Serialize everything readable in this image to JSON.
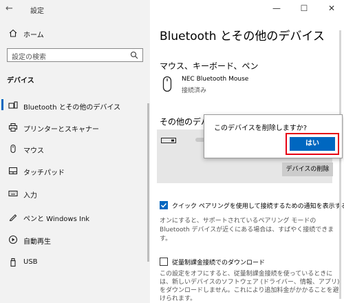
{
  "app": {
    "title": "設定"
  },
  "window": {
    "minimize": "—",
    "maximize": "☐",
    "close": "✕"
  },
  "sidebar": {
    "home_label": "ホーム",
    "search_placeholder": "設定の検索",
    "section_label": "デバイス",
    "items": [
      {
        "label": "Bluetooth とその他のデバイス",
        "icon": "bluetooth-devices-icon",
        "active": true
      },
      {
        "label": "プリンターとスキャナー",
        "icon": "printer-icon"
      },
      {
        "label": "マウス",
        "icon": "mouse-icon"
      },
      {
        "label": "タッチパッド",
        "icon": "touchpad-icon"
      },
      {
        "label": "入力",
        "icon": "keyboard-icon"
      },
      {
        "label": "ペンと Windows Ink",
        "icon": "pen-icon"
      },
      {
        "label": "自動再生",
        "icon": "autoplay-icon"
      },
      {
        "label": "USB",
        "icon": "usb-icon"
      }
    ]
  },
  "main": {
    "title": "Bluetooth とその他のデバイス",
    "section1": "マウス、キーボード、ペン",
    "device1": {
      "name": "NEC Bluetooth Mouse",
      "status": "接続済み"
    },
    "section2": "その他のデバ",
    "remove_button": "デバイスの削除",
    "option1": {
      "checked": true,
      "label": "クイック ペアリングを使用して接続するための通知を表示する",
      "description": "オンにすると、サポートされているペアリング モードの Bluetooth デバイスが近くにある場合は、すばやく接続できます。"
    },
    "option2": {
      "checked": false,
      "label": "従量制課金接続でのダウンロード",
      "description": "この設定をオフにすると、従量制課金接続を使っているときには、新しいデバイスのソフトウェア (ドライバー、情報、アプリ) をダウンロードしません。これにより追加料金がかかることを避けられます。"
    }
  },
  "dialog": {
    "message": "このデバイスを削除しますか?",
    "yes_label": "はい"
  },
  "colors": {
    "accent": "#0067c0",
    "highlight": "#e60012",
    "sidebar_bg": "#f2f2f2"
  }
}
